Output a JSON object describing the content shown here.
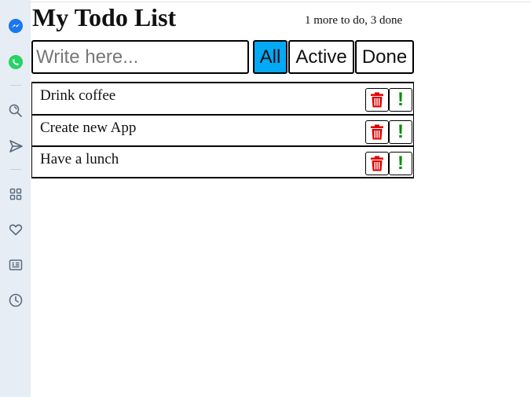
{
  "sidebar": {
    "items": [
      {
        "name": "messenger-icon",
        "color": "#1877f2"
      },
      {
        "name": "whatsapp-icon",
        "color": "#25d366"
      },
      {
        "name": "search-icon"
      },
      {
        "name": "send-icon"
      },
      {
        "name": "apps-grid-icon"
      },
      {
        "name": "heart-icon"
      },
      {
        "name": "news-icon"
      },
      {
        "name": "history-clock-icon"
      }
    ]
  },
  "app": {
    "title": "My Todo List",
    "status": "1 more to do, 3 done"
  },
  "input": {
    "placeholder": "Write here...",
    "value": ""
  },
  "filters": {
    "all": "All",
    "active": "Active",
    "done": "Done",
    "selected": "All",
    "selected_color": "#03a9f4"
  },
  "todos": [
    {
      "label": "Drink coffee"
    },
    {
      "label": "Create new App"
    },
    {
      "label": "Have a lunch"
    }
  ],
  "colors": {
    "delete_icon": "#e00000",
    "important_icon": "#0b8a0b"
  }
}
